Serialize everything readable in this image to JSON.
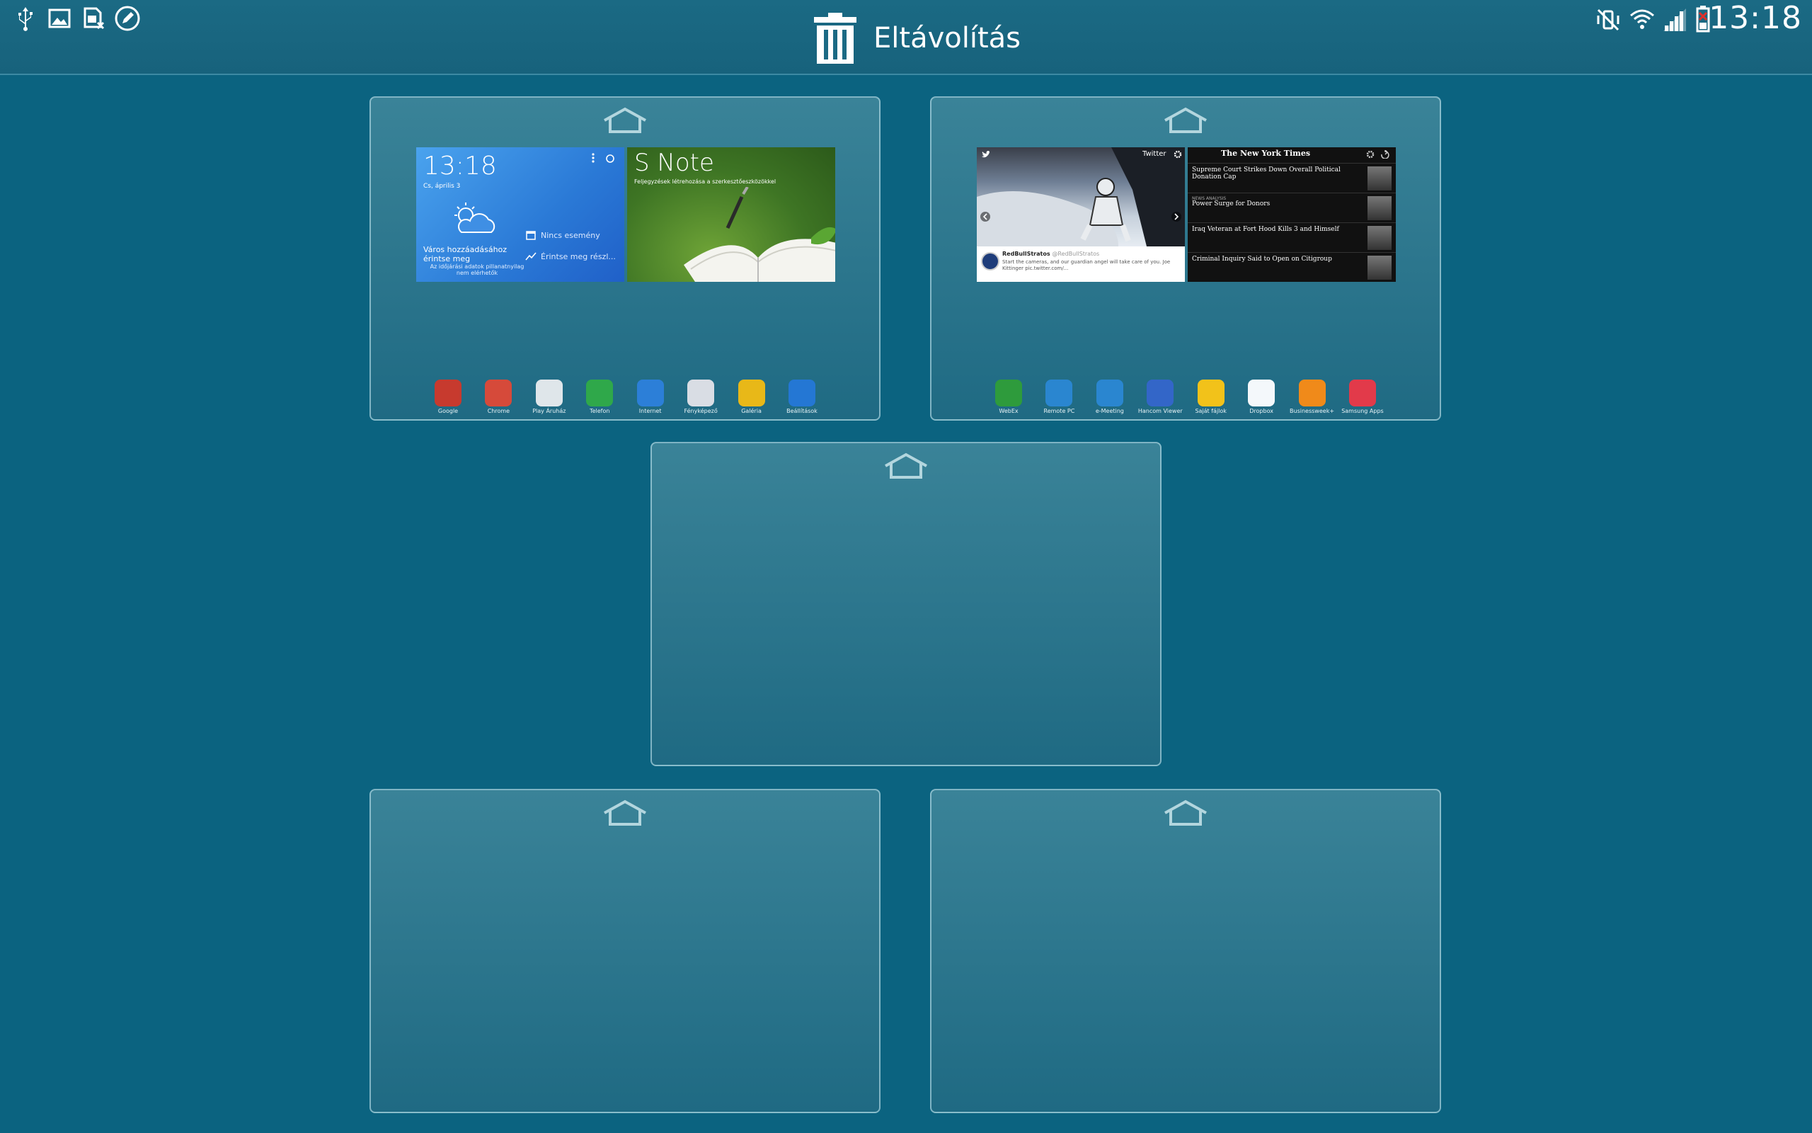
{
  "status_bar": {
    "time": "13:18",
    "left_icons": [
      "usb-icon",
      "gallery-icon",
      "sim-card-icon",
      "pen-note-icon"
    ],
    "right_icons": [
      "mute-vibrate-icon",
      "wifi-icon",
      "signal-icon",
      "battery-icon"
    ]
  },
  "remove_zone": {
    "label": "Eltávolítás"
  },
  "panels": [
    {
      "clock_widget": {
        "time": "13:18",
        "date": "Cs, április 3",
        "city_prompt": "Város hozzáadásához érintse meg",
        "weather_note": "Az időjárási adatok pillanatnyilag nem elérhetők",
        "event_text": "Nincs esemény",
        "touch_text": "Érintse meg részl..."
      },
      "snote_widget": {
        "title": "S Note",
        "subtitle": "Feljegyzések létrehozása a szerkesztőeszközökkel"
      },
      "apps": [
        {
          "label": "Google",
          "icon": "google-folder-icon",
          "color": "#c73a2e"
        },
        {
          "label": "Chrome",
          "icon": "chrome-icon",
          "color": "#d64a3a"
        },
        {
          "label": "Play Áruház",
          "icon": "play-store-icon",
          "color": "#dfe6ea"
        },
        {
          "label": "Telefon",
          "icon": "phone-icon",
          "color": "#2fa84a"
        },
        {
          "label": "Internet",
          "icon": "globe-icon",
          "color": "#2c7fd8"
        },
        {
          "label": "Fényképező",
          "icon": "camera-icon",
          "color": "#d9dde4"
        },
        {
          "label": "Galéria",
          "icon": "gallery-icon",
          "color": "#e8b818"
        },
        {
          "label": "Beállítások",
          "icon": "settings-icon",
          "color": "#2477d4"
        }
      ]
    },
    {
      "twitter_widget": {
        "brand": "Twitter",
        "account": "RedBullStratos",
        "handle": "@RedBullStratos",
        "tweet": "Start the cameras, and our guardian angel will take care of you. Joe Kittinger pic.twitter.com/..."
      },
      "nyt_widget": {
        "brand": "The New York Times",
        "headlines": [
          {
            "section": "",
            "title": "Supreme Court Strikes Down Overall Political Donation Cap"
          },
          {
            "section": "NEWS ANALYSIS",
            "title": "Power Surge for Donors"
          },
          {
            "section": "",
            "title": "Iraq Veteran at Fort Hood Kills 3 and Himself"
          },
          {
            "section": "",
            "title": "Criminal Inquiry Said to Open on Citigroup"
          }
        ]
      },
      "apps": [
        {
          "label": "WebEx",
          "icon": "webex-icon",
          "color": "#2e9b3c"
        },
        {
          "label": "Remote PC",
          "icon": "remote-pc-icon",
          "color": "#2a86d0"
        },
        {
          "label": "e-Meeting",
          "icon": "e-meeting-icon",
          "color": "#2a86d0"
        },
        {
          "label": "Hancom Viewer",
          "icon": "hancom-viewer-icon",
          "color": "#3366c8"
        },
        {
          "label": "Saját fájlok",
          "icon": "folder-icon",
          "color": "#f2c21a"
        },
        {
          "label": "Dropbox",
          "icon": "dropbox-icon",
          "color": "#f4f8fb"
        },
        {
          "label": "Businessweek+",
          "icon": "businessweek-icon",
          "color": "#f08a1a"
        },
        {
          "label": "Samsung Apps",
          "icon": "samsung-apps-icon",
          "color": "#e23a4a"
        }
      ]
    }
  ]
}
